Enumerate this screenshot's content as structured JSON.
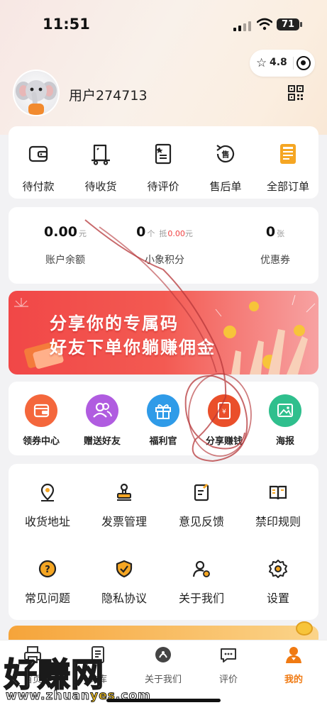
{
  "status_bar": {
    "time": "11:51",
    "battery": "71"
  },
  "header": {
    "rating": "4.8",
    "username": "用户274713"
  },
  "orders": [
    {
      "label": "待付款",
      "icon": "wallet-icon"
    },
    {
      "label": "待收货",
      "icon": "delivery-cart-icon"
    },
    {
      "label": "待评价",
      "icon": "review-document-icon"
    },
    {
      "label": "售后单",
      "icon": "after-sales-icon"
    },
    {
      "label": "全部订单",
      "icon": "all-orders-icon"
    }
  ],
  "assets": {
    "balance": {
      "value": "0.00",
      "unit": "元",
      "label": "账户余额"
    },
    "points": {
      "value": "0",
      "unit": "个",
      "deduct_prefix": "抵",
      "deduct_value": "0.00",
      "deduct_unit": "元",
      "label": "小象积分"
    },
    "coupons": {
      "value": "0",
      "unit": "张",
      "label": "优惠券"
    }
  },
  "banner": {
    "line1": "分享你的专属码",
    "line2": "好友下单你躺赚佣金"
  },
  "tools": [
    {
      "label": "领券中心",
      "color": "#f4673c",
      "icon": "coupon-wallet-icon"
    },
    {
      "label": "赠送好友",
      "color": "#b05ce0",
      "icon": "friends-icon"
    },
    {
      "label": "福利官",
      "color": "#2f9be8",
      "icon": "gift-icon"
    },
    {
      "label": "分享赚钱",
      "color": "#ea4f2a",
      "icon": "red-envelope-icon"
    },
    {
      "label": "海报",
      "color": "#2fbf8d",
      "icon": "poster-image-icon"
    }
  ],
  "services": [
    {
      "label": "收货地址",
      "icon": "location-pin-icon"
    },
    {
      "label": "发票管理",
      "icon": "stamp-icon"
    },
    {
      "label": "意见反馈",
      "icon": "feedback-edit-icon"
    },
    {
      "label": "禁印规则",
      "icon": "rules-book-icon"
    },
    {
      "label": "常见问题",
      "icon": "question-icon"
    },
    {
      "label": "隐私协议",
      "icon": "shield-check-icon"
    },
    {
      "label": "关于我们",
      "icon": "user-gear-icon"
    },
    {
      "label": "设置",
      "icon": "settings-gear-icon"
    }
  ],
  "tabs": [
    {
      "label": "首页",
      "icon": "printer-icon",
      "active": false
    },
    {
      "label": "文库",
      "icon": "library-icon",
      "active": false
    },
    {
      "label": "关于我们",
      "icon": "about-icon",
      "active": false
    },
    {
      "label": "评价",
      "icon": "review-icon",
      "active": false
    },
    {
      "label": "我的",
      "icon": "profile-icon",
      "active": true
    }
  ],
  "watermark": {
    "main": "好赚网",
    "domain_prefix": "www.zhuan",
    "domain_highlight": "yes",
    "domain_suffix": ".com"
  },
  "colors": {
    "accent_orange": "#f07a12",
    "banner_red": "#f14747"
  }
}
